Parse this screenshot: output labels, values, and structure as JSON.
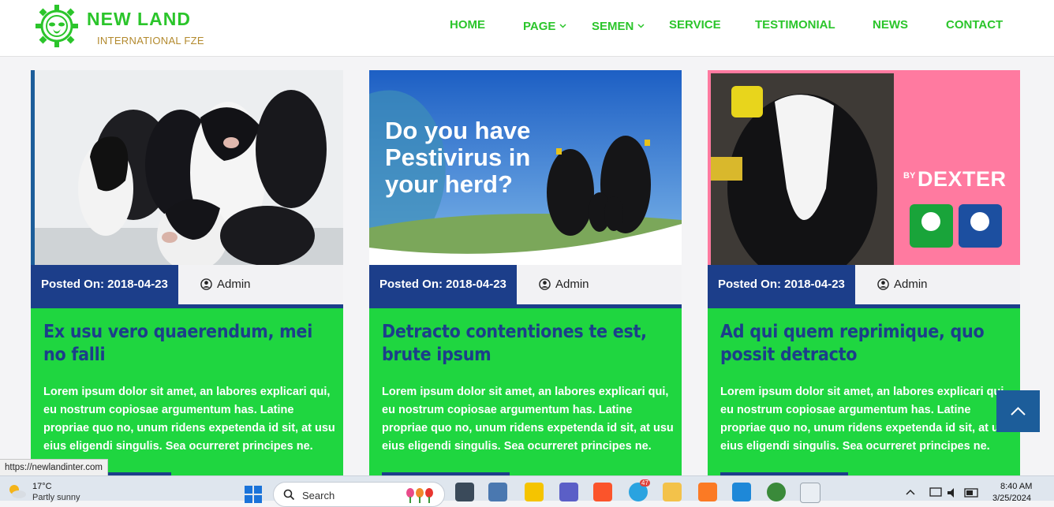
{
  "header": {
    "logo": {
      "name": "NEW LAND",
      "subtitle": "INTERNATIONAL FZE"
    },
    "nav": [
      {
        "label": "HOME",
        "dropdown": false
      },
      {
        "label": "PAGE",
        "dropdown": true
      },
      {
        "label": "SEMEN",
        "dropdown": true
      },
      {
        "label": "SERVICE",
        "dropdown": false
      },
      {
        "label": "TESTIMONIAL",
        "dropdown": false
      },
      {
        "label": "NEWS",
        "dropdown": false
      },
      {
        "label": "CONTACT",
        "dropdown": false
      }
    ]
  },
  "cards": [
    {
      "image": "calves-photo",
      "date": "Posted On: 2018-04-23",
      "author": "Admin",
      "title": "Ex usu vero quaerendum, mei no falli",
      "text": "Lorem ipsum dolor sit amet, an labores explicari qui, eu nostrum copiosae argumentum has. Latine propriae quo no, unum ridens expetenda id sit, at usu eius eligendi singulis. Sea ocurreret principes ne."
    },
    {
      "image": "pestivirus-banner",
      "banner_text": "Do you have Pestivirus in your herd?",
      "date": "Posted On: 2018-04-23",
      "author": "Admin",
      "title": "Detracto contentiones te est, brute ipsum",
      "text": "Lorem ipsum dolor sit amet, an labores explicari qui, eu nostrum copiosae argumentum has. Latine propriae quo no, unum ridens expetenda id sit, at usu eius eligendi singulis. Sea ocurreret principes ne."
    },
    {
      "image": "dexter-banner",
      "banner_by": "BY",
      "banner_brand": "DEXTER",
      "date": "Posted On: 2018-04-23",
      "author": "Admin",
      "title": "Ad qui quem reprimique, quo possit detracto",
      "text": "Lorem ipsum dolor sit amet, an labores explicari qui, eu nostrum copiosae argumentum has. Latine propriae quo no, unum ridens expetenda id sit, at usu eius eligendi singulis. Sea ocurreret principes ne."
    }
  ],
  "status_link": "https://newlandinter.com",
  "taskbar": {
    "weather_temp": "17°C",
    "weather_desc": "Partly sunny",
    "search_label": "Search",
    "time": "8:40 AM",
    "date": "3/25/2024",
    "telegram_badge": "47"
  },
  "colors": {
    "green": "#2bc52b",
    "card_green": "#1fd640",
    "navy": "#1c3e8a"
  }
}
